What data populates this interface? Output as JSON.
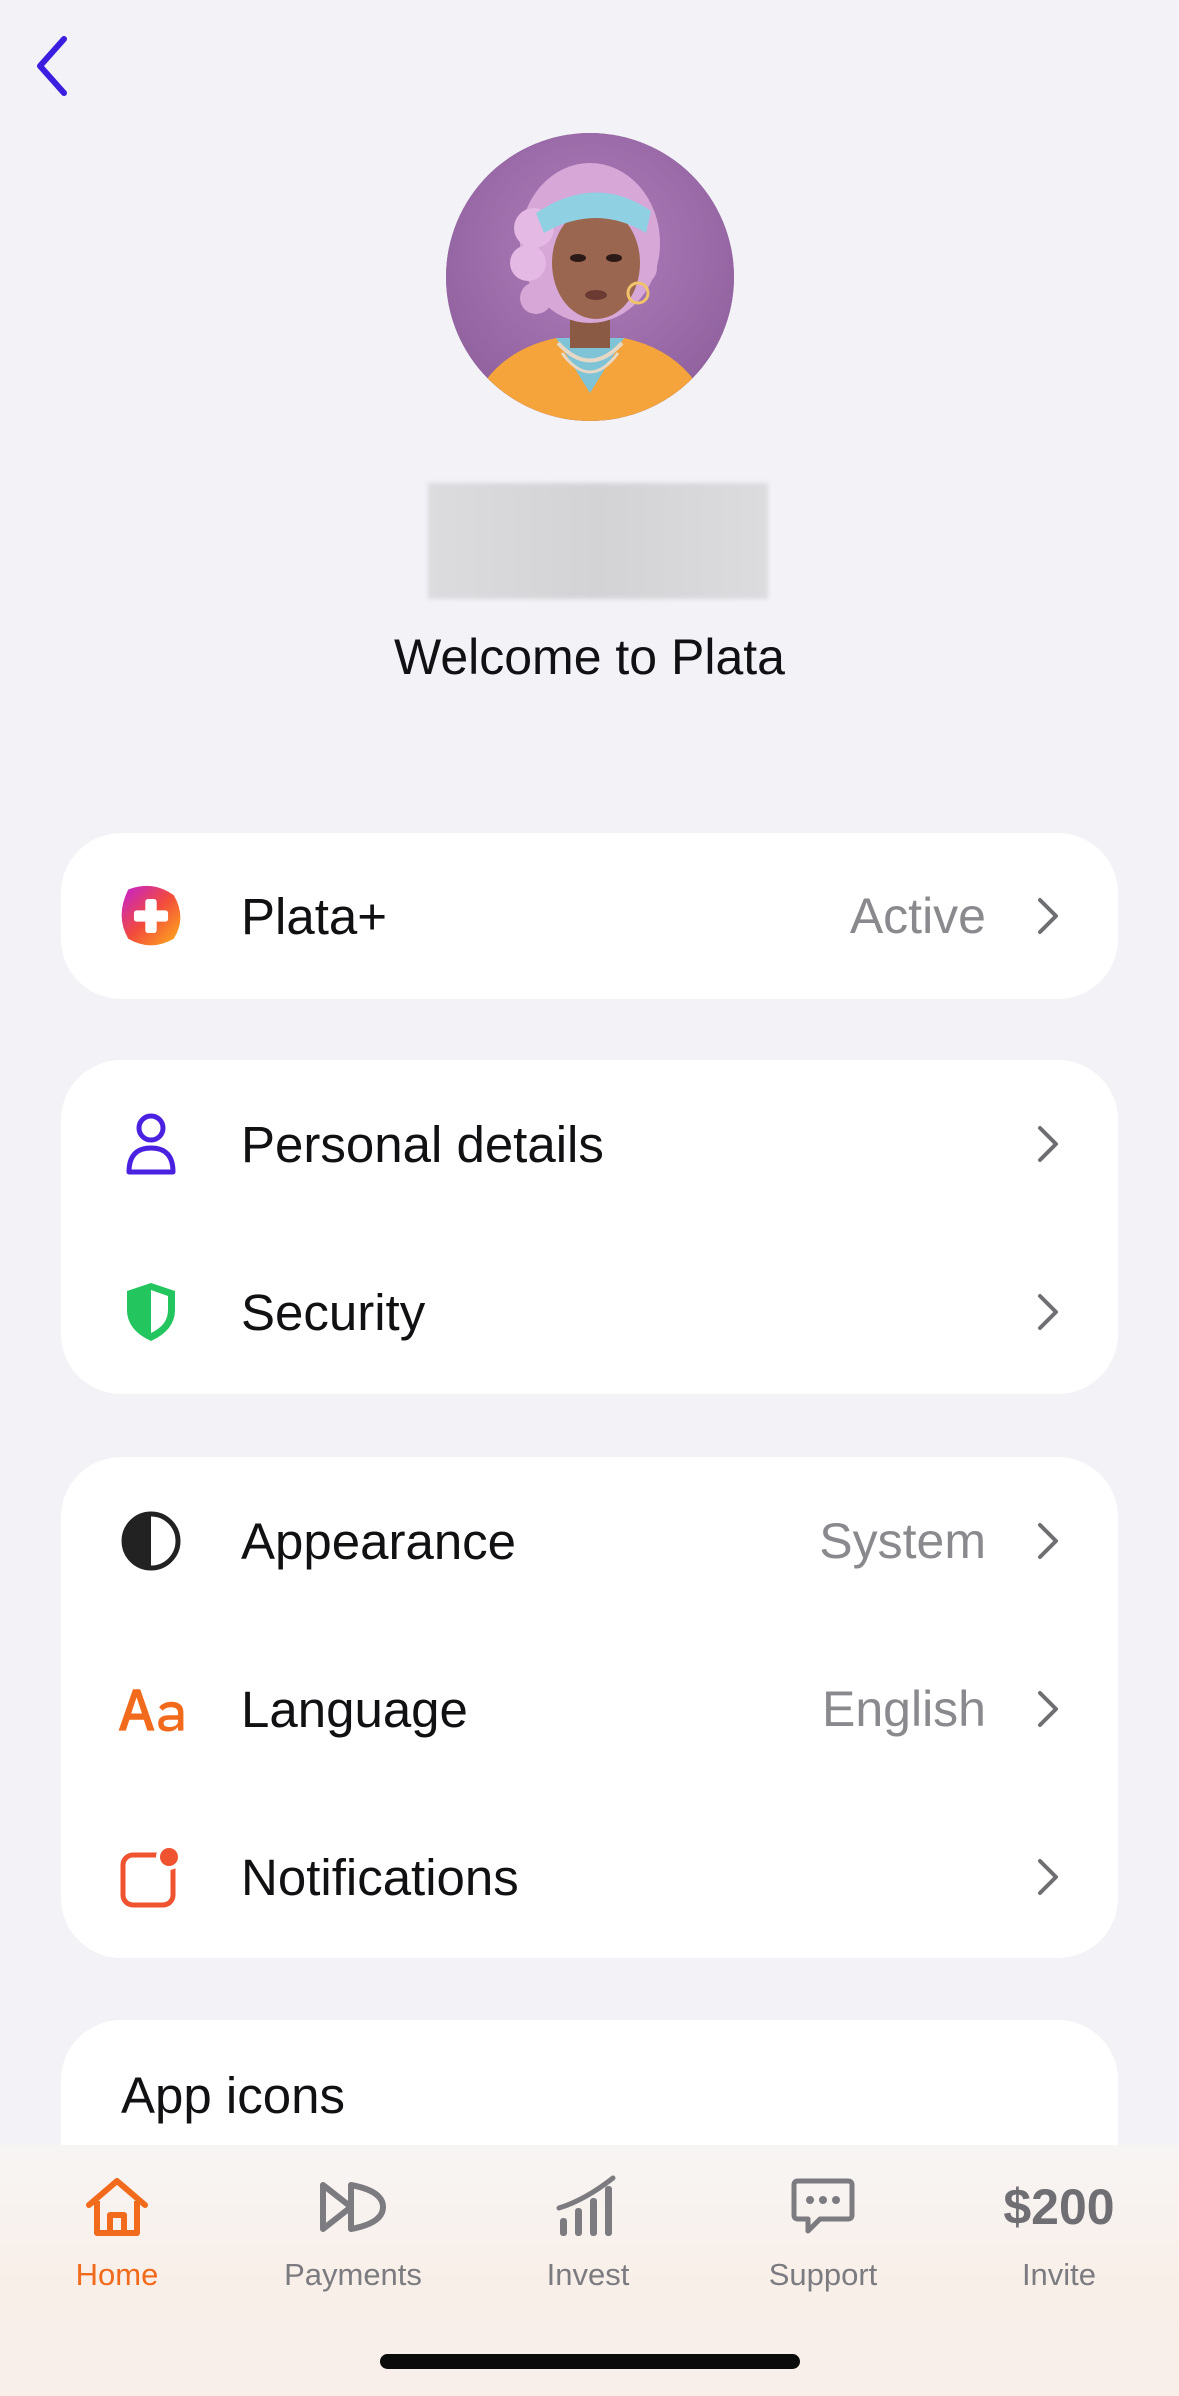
{
  "header": {
    "back_icon": "chevron-left-icon",
    "accent": "#3a1fe0"
  },
  "profile": {
    "avatar_desc": "profile-avatar",
    "welcome_text": "Welcome to Plata"
  },
  "card_plus": {
    "rows": [
      {
        "label": "Plata+",
        "value": "Active",
        "icon": "plata-plus-icon"
      }
    ]
  },
  "card_account": {
    "rows": [
      {
        "label": "Personal details",
        "value": "",
        "icon": "person-icon"
      },
      {
        "label": "Security",
        "value": "",
        "icon": "shield-icon"
      }
    ]
  },
  "card_prefs": {
    "rows": [
      {
        "label": "Appearance",
        "value": "System",
        "icon": "contrast-icon"
      },
      {
        "label": "Language",
        "value": "English",
        "icon": "text-aa-icon"
      },
      {
        "label": "Notifications",
        "value": "",
        "icon": "notification-badge-icon"
      }
    ]
  },
  "card_app_icons": {
    "title": "App icons"
  },
  "tabbar": {
    "active_color": "#f26a1b",
    "tabs": [
      {
        "label": "Home",
        "icon": "home-icon",
        "active": true
      },
      {
        "label": "Payments",
        "icon": "fast-forward-icon",
        "active": false
      },
      {
        "label": "Invest",
        "icon": "bar-chart-icon",
        "active": false
      },
      {
        "label": "Support",
        "icon": "chat-bubble-icon",
        "active": false
      },
      {
        "label": "Invite",
        "icon": "invite-amount",
        "amount": "$200",
        "active": false
      }
    ]
  }
}
